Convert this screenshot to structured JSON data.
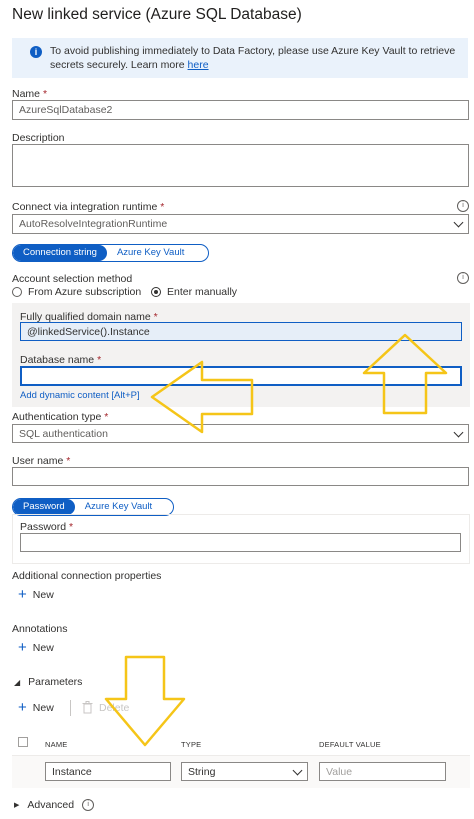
{
  "title": "New linked service (Azure SQL Database)",
  "banner": {
    "text": "To avoid publishing immediately to Data Factory, please use Azure Key Vault to retrieve secrets securely. Learn more ",
    "link": "here"
  },
  "name": {
    "label": "Name",
    "value": "AzureSqlDatabase2"
  },
  "description": {
    "label": "Description",
    "value": ""
  },
  "runtime": {
    "label": "Connect via integration runtime",
    "value": "AutoResolveIntegrationRuntime"
  },
  "conn_toggle": {
    "on": "Connection string",
    "off": "Azure Key Vault"
  },
  "account": {
    "label": "Account selection method",
    "opt1": "From Azure subscription",
    "opt2": "Enter manually",
    "selected": "Enter manually"
  },
  "fqdn": {
    "label": "Fully qualified domain name",
    "value": "@linkedService().Instance"
  },
  "database": {
    "label": "Database name",
    "value": "",
    "dynamic": "Add dynamic content [Alt+P]"
  },
  "auth": {
    "label": "Authentication type",
    "value": "SQL authentication"
  },
  "user": {
    "label": "User name",
    "value": ""
  },
  "pwd_toggle": {
    "on": "Password",
    "off": "Azure Key Vault"
  },
  "password": {
    "label": "Password",
    "value": ""
  },
  "additional": {
    "label": "Additional connection properties",
    "new": "New"
  },
  "annotations": {
    "label": "Annotations",
    "new": "New"
  },
  "parameters": {
    "label": "Parameters",
    "new": "New",
    "delete": "Delete",
    "columns": [
      "NAME",
      "TYPE",
      "DEFAULT VALUE"
    ],
    "rows": [
      {
        "name": "Instance",
        "type": "String",
        "default_placeholder": "Value"
      }
    ]
  },
  "advanced": {
    "label": "Advanced"
  },
  "colors": {
    "accent": "#0f5ec4",
    "arrow": "#f5c518",
    "required": "#a4262c"
  },
  "icons": [
    "info-icon",
    "chevron-down-icon",
    "plus-icon",
    "trash-icon",
    "caret-right-icon",
    "caret-down-icon"
  ]
}
